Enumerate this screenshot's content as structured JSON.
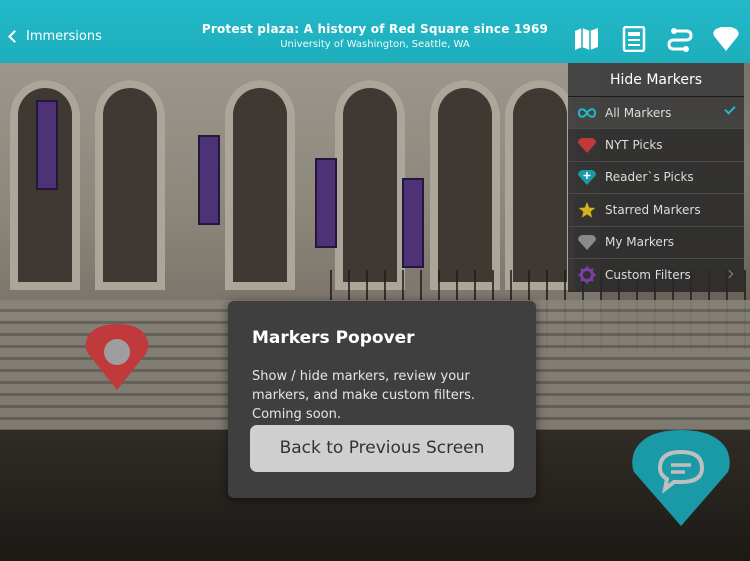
{
  "header": {
    "back_label": "Immersions",
    "title": "Protest plaza: A history of Red Square since 1969",
    "subtitle": "University of Washington, Seattle, WA"
  },
  "toolbar": {
    "icons": [
      "map-icon",
      "article-icon",
      "route-icon",
      "marker-filter-icon"
    ]
  },
  "markers_menu": {
    "header": "Hide Markers",
    "items": [
      {
        "label": "All Markers",
        "icon": "infinity-icon",
        "selected": true
      },
      {
        "label": "NYT Picks",
        "icon": "red-diamond-icon"
      },
      {
        "label": "Reader`s Picks",
        "icon": "teal-plus-diamond-icon"
      },
      {
        "label": "Starred Markers",
        "icon": "star-icon"
      },
      {
        "label": "My Markers",
        "icon": "gray-diamond-icon"
      },
      {
        "label": "Custom Filters",
        "icon": "gear-icon",
        "has_submenu": true
      }
    ]
  },
  "popover": {
    "title": "Markers Popover",
    "body": "Show / hide markers, review your markers, and make custom filters. Coming soon.",
    "button_label": "Back to Previous Screen"
  },
  "colors": {
    "accent": "#22b9c9",
    "red_marker": "#c0393b",
    "teal_marker": "#1a9aa6",
    "star": "#d4b21e",
    "purple": "#7b3fa6"
  }
}
